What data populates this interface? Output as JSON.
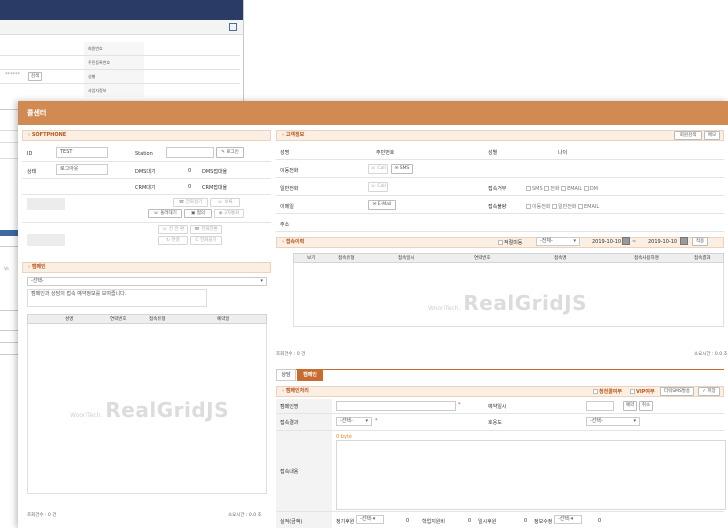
{
  "bg": {
    "labels": [
      "회원번호",
      "주민등록번호",
      "성별",
      "사업자정보"
    ],
    "masked_value": "******",
    "verify_btn": "검색"
  },
  "left_strip": {
    "items": [
      "V",
      "Ve"
    ]
  },
  "main": {
    "title": "콜센터",
    "softphone": {
      "header": "SOFTPHONE",
      "id_label": "ID",
      "id_value": "TEST",
      "station_label": "Station",
      "login_btn": "로그인",
      "status_label": "상태",
      "status_value": "로그아웃",
      "dms_label": "DMS대기",
      "dms_count": "0",
      "dms_status": "DMS접대율",
      "crm_label": "CRM대기",
      "crm_count": "0",
      "crm_status": "CRM접대율",
      "btn_call_connect": "전화걸기",
      "btn_hold": "보류",
      "btn_transfer": "돌려대기",
      "btn_meeting": "협의",
      "btn_three": "3자통화",
      "btn_switch1": "전 전 환",
      "btn_switch2": "전화전환",
      "btn_connect": "연결",
      "btn_disconnect": "전화끊기"
    },
    "campaign": {
      "header": "캠페인",
      "select_value": "-선택-",
      "memo": "캠페인과 상담의 접속 예약정보를 보여줍니다.",
      "columns": [
        "성명",
        "연락번호",
        "접속유형",
        "예약일"
      ],
      "total": "조회건수 : 0 건",
      "elapsed": "소요시간 : 0.0 초"
    },
    "customer": {
      "header": "고객정보",
      "btn_search": "회원검색",
      "btn_memo": "메모",
      "name_label": "성명",
      "jumin_label": "주민번호",
      "gender_label": "성별",
      "age_label": "나이",
      "mobile_label": "이동전화",
      "btn_call": "Call",
      "btn_sms": "SMS",
      "phone_label": "일반전화",
      "reject_label": "접속거부",
      "reject_opts": [
        "SMS",
        "전화",
        "EMAIL",
        "DM"
      ],
      "email_label": "이메일",
      "btn_email": "E-Mail",
      "bad_label": "접속불량",
      "bad_opts": [
        "이동전화",
        "일반전화",
        "EMAIL"
      ],
      "addr_label": "주소"
    },
    "history": {
      "header": "접속이력",
      "kind_check": "적절미등",
      "kind_select": "-전체-",
      "date_from": "2019-10-10",
      "date_to": "2019-10-10",
      "btn_apply": "적용",
      "columns": [
        "보기",
        "접속유형",
        "접속일시",
        "연락번호",
        "접속명",
        "접속사용자명",
        "접속결과"
      ],
      "total": "조회건수 : 0 건",
      "elapsed": "소요시간 : 0.0 초"
    },
    "tabs": {
      "consult": "상담",
      "campaign": "캠페인"
    },
    "campaign_proc": {
      "header": "캠페인처리",
      "chk_cherry": "청천콜여부",
      "chk_vip": "VIP여부",
      "btn_sms_tpl": "더워SMS발송",
      "btn_save": "저장",
      "campaign_label": "캠페인명",
      "reserve_label": "예약일시",
      "btn_reserve": "예약",
      "btn_cancel": "취소",
      "result_label": "접속결과",
      "result_select": "-선택-",
      "satisfy_label": "호응도",
      "satisfy_select": "-선택-",
      "content_label": "접속내용",
      "byte_count": "0 byte",
      "perf_label": "실적(금액)",
      "perf_items": [
        {
          "label": "정기후원",
          "select": "-선택-",
          "value": "0"
        },
        {
          "label": "학업지원비",
          "value": "0"
        },
        {
          "label": "일시후원",
          "value": "0"
        },
        {
          "label": "정보수정",
          "select": "-선택-",
          "value": "0"
        }
      ]
    },
    "watermark": {
      "small": "WooriTech.",
      "big": "RealGridJS"
    }
  }
}
